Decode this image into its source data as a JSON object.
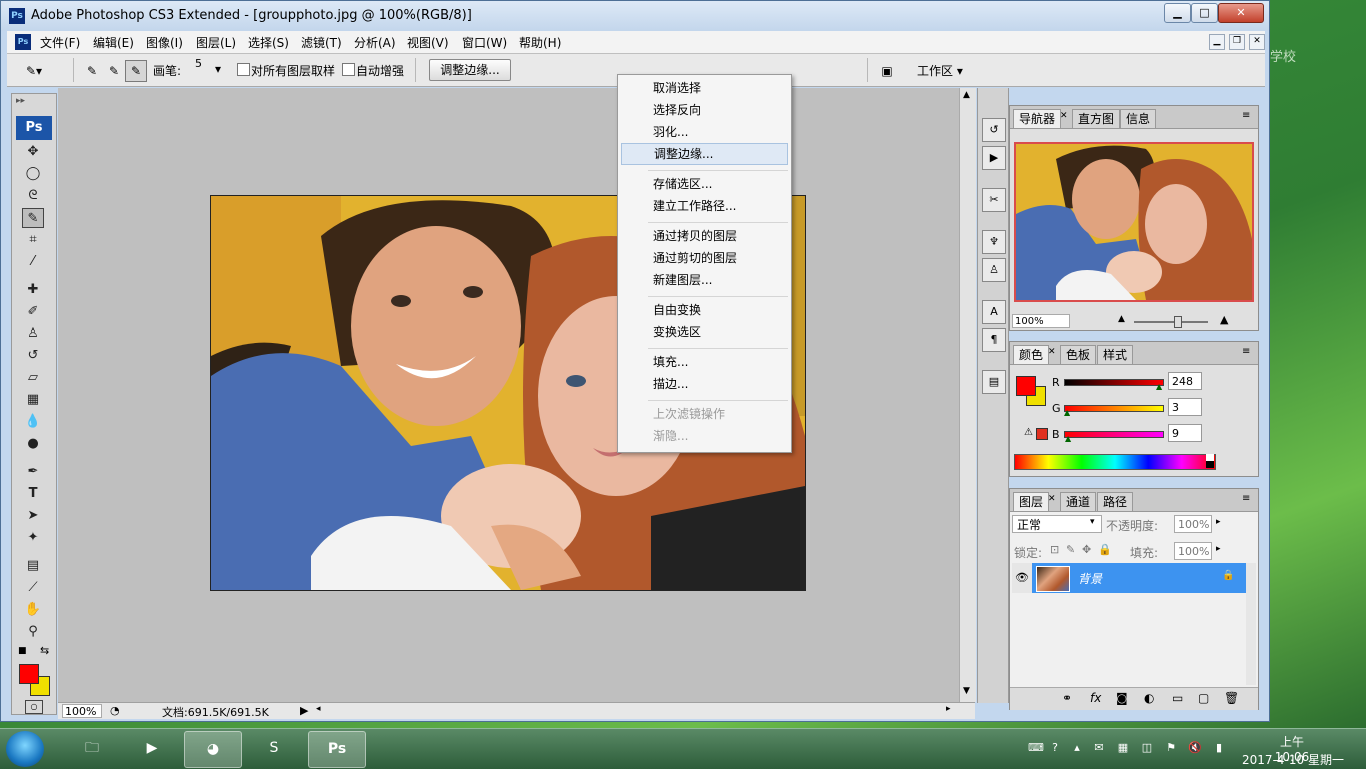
{
  "window": {
    "title": "Adobe Photoshop CS3 Extended - [groupphoto.jpg @ 100%(RGB/8)]",
    "app_icon": "Ps",
    "minimize": "▁",
    "maximize": "□",
    "close": "✕"
  },
  "desktop_logo": "学校",
  "menubar": {
    "items": [
      "文件(F)",
      "编辑(E)",
      "图像(I)",
      "图层(L)",
      "选择(S)",
      "滤镜(T)",
      "分析(A)",
      "视图(V)",
      "窗口(W)",
      "帮助(H)"
    ]
  },
  "options": {
    "brush_label": "画笔:",
    "brush_size": "5",
    "sample_all_layers": "对所有图层取样",
    "auto_enhance": "自动增强",
    "refine_edge": "调整边缘...",
    "workspace": "工作区 ▾"
  },
  "toolbox": {
    "logo": "Ps"
  },
  "context_menu": {
    "items": [
      "取消选择",
      "选择反向",
      "羽化...",
      "调整边缘...",
      "存储选区...",
      "建立工作路径...",
      "通过拷贝的图层",
      "通过剪切的图层",
      "新建图层...",
      "自由变换",
      "变换选区",
      "填充...",
      "描边...",
      "上次滤镜操作",
      "渐隐..."
    ],
    "highlighted_index": 3,
    "disabled_indices": [
      13,
      14
    ]
  },
  "status": {
    "zoom": "100%",
    "doc": "文档:691.5K/691.5K"
  },
  "navigator": {
    "tabs": [
      "导航器",
      "直方图",
      "信息"
    ],
    "zoom": "100%"
  },
  "color_panel": {
    "tabs": [
      "颜色",
      "色板",
      "样式"
    ],
    "r_label": "R",
    "g_label": "G",
    "b_label": "B",
    "r": "248",
    "g": "3",
    "b": "9",
    "fg_color": "#f80309",
    "bg_color": "#f0e000"
  },
  "layers_panel": {
    "tabs": [
      "图层",
      "通道",
      "路径"
    ],
    "blend_mode": "正常",
    "opacity_label": "不透明度:",
    "opacity": "100%",
    "lock_label": "锁定:",
    "fill_label": "填充:",
    "fill": "100%",
    "layer_name": "背景"
  },
  "taskbar": {
    "time": "上午 10:06",
    "date": "2017-4-10 星期一",
    "ps_label": "Ps"
  }
}
